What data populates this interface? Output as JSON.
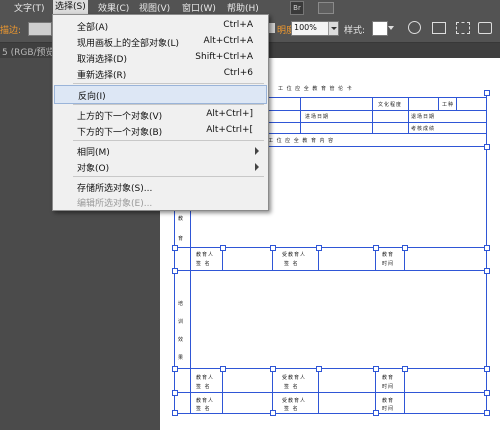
{
  "menubar": {
    "items": [
      {
        "label": "文字(T)"
      },
      {
        "label": "选择(S)"
      },
      {
        "label": "效果(C)"
      },
      {
        "label": "视图(V)"
      },
      {
        "label": "窗口(W)"
      },
      {
        "label": "帮助(H)"
      }
    ],
    "bridge_badge": "Br"
  },
  "toolbar": {
    "stroke_label": "描边:",
    "opacity_label": "明度",
    "opacity_value": "100%",
    "style_label": "样式:"
  },
  "doc_tab": {
    "label": "5 (RGB/预览)"
  },
  "select_menu": {
    "items": [
      {
        "label": "全部(A)",
        "shortcut": "Ctrl+A"
      },
      {
        "label": "现用画板上的全部对象(L)",
        "shortcut": "Alt+Ctrl+A"
      },
      {
        "label": "取消选择(D)",
        "shortcut": "Shift+Ctrl+A"
      },
      {
        "label": "重新选择(R)",
        "shortcut": "Ctrl+6"
      },
      {
        "label": "反向(I)",
        "shortcut": ""
      },
      {
        "label": "上方的下一个对象(V)",
        "shortcut": "Alt+Ctrl+]"
      },
      {
        "label": "下方的下一个对象(B)",
        "shortcut": "Alt+Ctrl+["
      },
      {
        "label": "相同(M)",
        "shortcut": ""
      },
      {
        "label": "对象(O)",
        "shortcut": ""
      },
      {
        "label": "存储所选对象(S)...",
        "shortcut": ""
      },
      {
        "label": "编辑所选对象(E)...",
        "shortcut": ""
      }
    ]
  },
  "document": {
    "title": "工 位 应 全 教 育 管 伦 卡",
    "cells": [
      "文化程度",
      "工种",
      "进场日期",
      "退场日期",
      "考核成绩",
      "工 位 应 全 教 育 内 容",
      "教",
      "育",
      "教育人",
      "签 名",
      "受教育人",
      "签 名",
      "教育",
      "时间",
      "培",
      "训",
      "效",
      "果",
      "教育人",
      "签 名",
      "受教育人",
      "签 名",
      "教育",
      "时间",
      "教育人",
      "签 名",
      "受教育人",
      "签 名",
      "教育",
      "时间"
    ]
  },
  "colors": {
    "selection": "#2f56d6",
    "menu_highlight": "#dde7f5",
    "stroke_label": "#f29a2e"
  }
}
